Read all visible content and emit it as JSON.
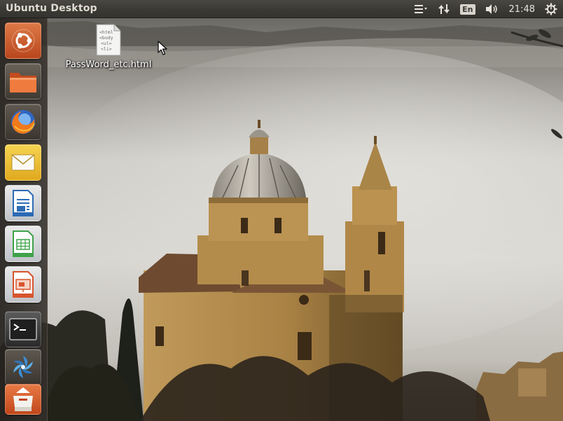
{
  "panel": {
    "title": "Ubuntu Desktop",
    "indicators": {
      "menu_icon": "menu-icon",
      "network_icon": "network-updown-icon",
      "keyboard_layout": "En",
      "sound_icon": "volume-icon",
      "clock": "21:48",
      "session_icon": "gear-power-icon"
    }
  },
  "launcher": {
    "items": [
      {
        "name": "dash-home",
        "icon": "ubuntu-logo-icon",
        "color": "#d9632c"
      },
      {
        "name": "files",
        "icon": "folder-icon",
        "color": "#e8763a"
      },
      {
        "name": "firefox",
        "icon": "firefox-icon",
        "color": "#e66000"
      },
      {
        "name": "mail",
        "icon": "mail-icon",
        "color": "#f3c637"
      },
      {
        "name": "writer",
        "icon": "writer-icon",
        "color": "#2d6bb5"
      },
      {
        "name": "calc",
        "icon": "calc-icon",
        "color": "#3fa24a"
      },
      {
        "name": "impress",
        "icon": "impress-icon",
        "color": "#d7542d"
      },
      {
        "name": "terminal",
        "icon": "terminal-icon",
        "color": "#2c2c2c"
      },
      {
        "name": "shotwell",
        "icon": "shotwell-icon",
        "color": "#3a8fd6"
      },
      {
        "name": "software-center",
        "icon": "software-center-icon",
        "color": "#e2692d"
      }
    ]
  },
  "desktop": {
    "file": {
      "label": "PassWord_etc.html",
      "icon": "html-file-icon",
      "glyph_lines": [
        "<html",
        "<body",
        "<ul>",
        "<li>"
      ]
    }
  },
  "colors": {
    "panel": "#3c3b37",
    "accent": "#dd4814"
  }
}
